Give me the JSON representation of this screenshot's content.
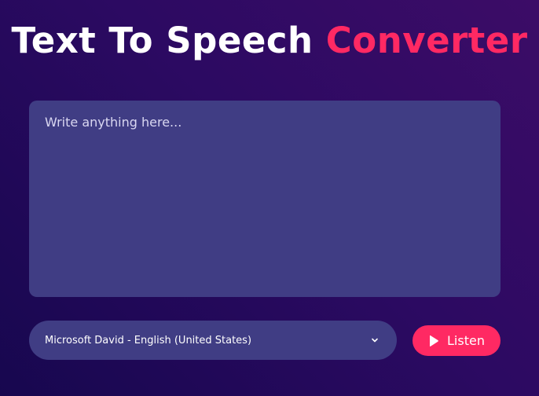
{
  "header": {
    "title_part1": "Text To Speech",
    "title_part2": "Converter",
    "accent_color": "#ff2963"
  },
  "text_input": {
    "placeholder": "Write anything here...",
    "value": ""
  },
  "voice_select": {
    "selected": "Microsoft David - English (United States)",
    "icon": "chevron-down-icon"
  },
  "listen_button": {
    "label": "Listen",
    "icon": "play-icon"
  },
  "colors": {
    "background_start": "#17074f",
    "background_end": "#3c0c67",
    "panel": "#403d84",
    "accent": "#ff2963"
  }
}
